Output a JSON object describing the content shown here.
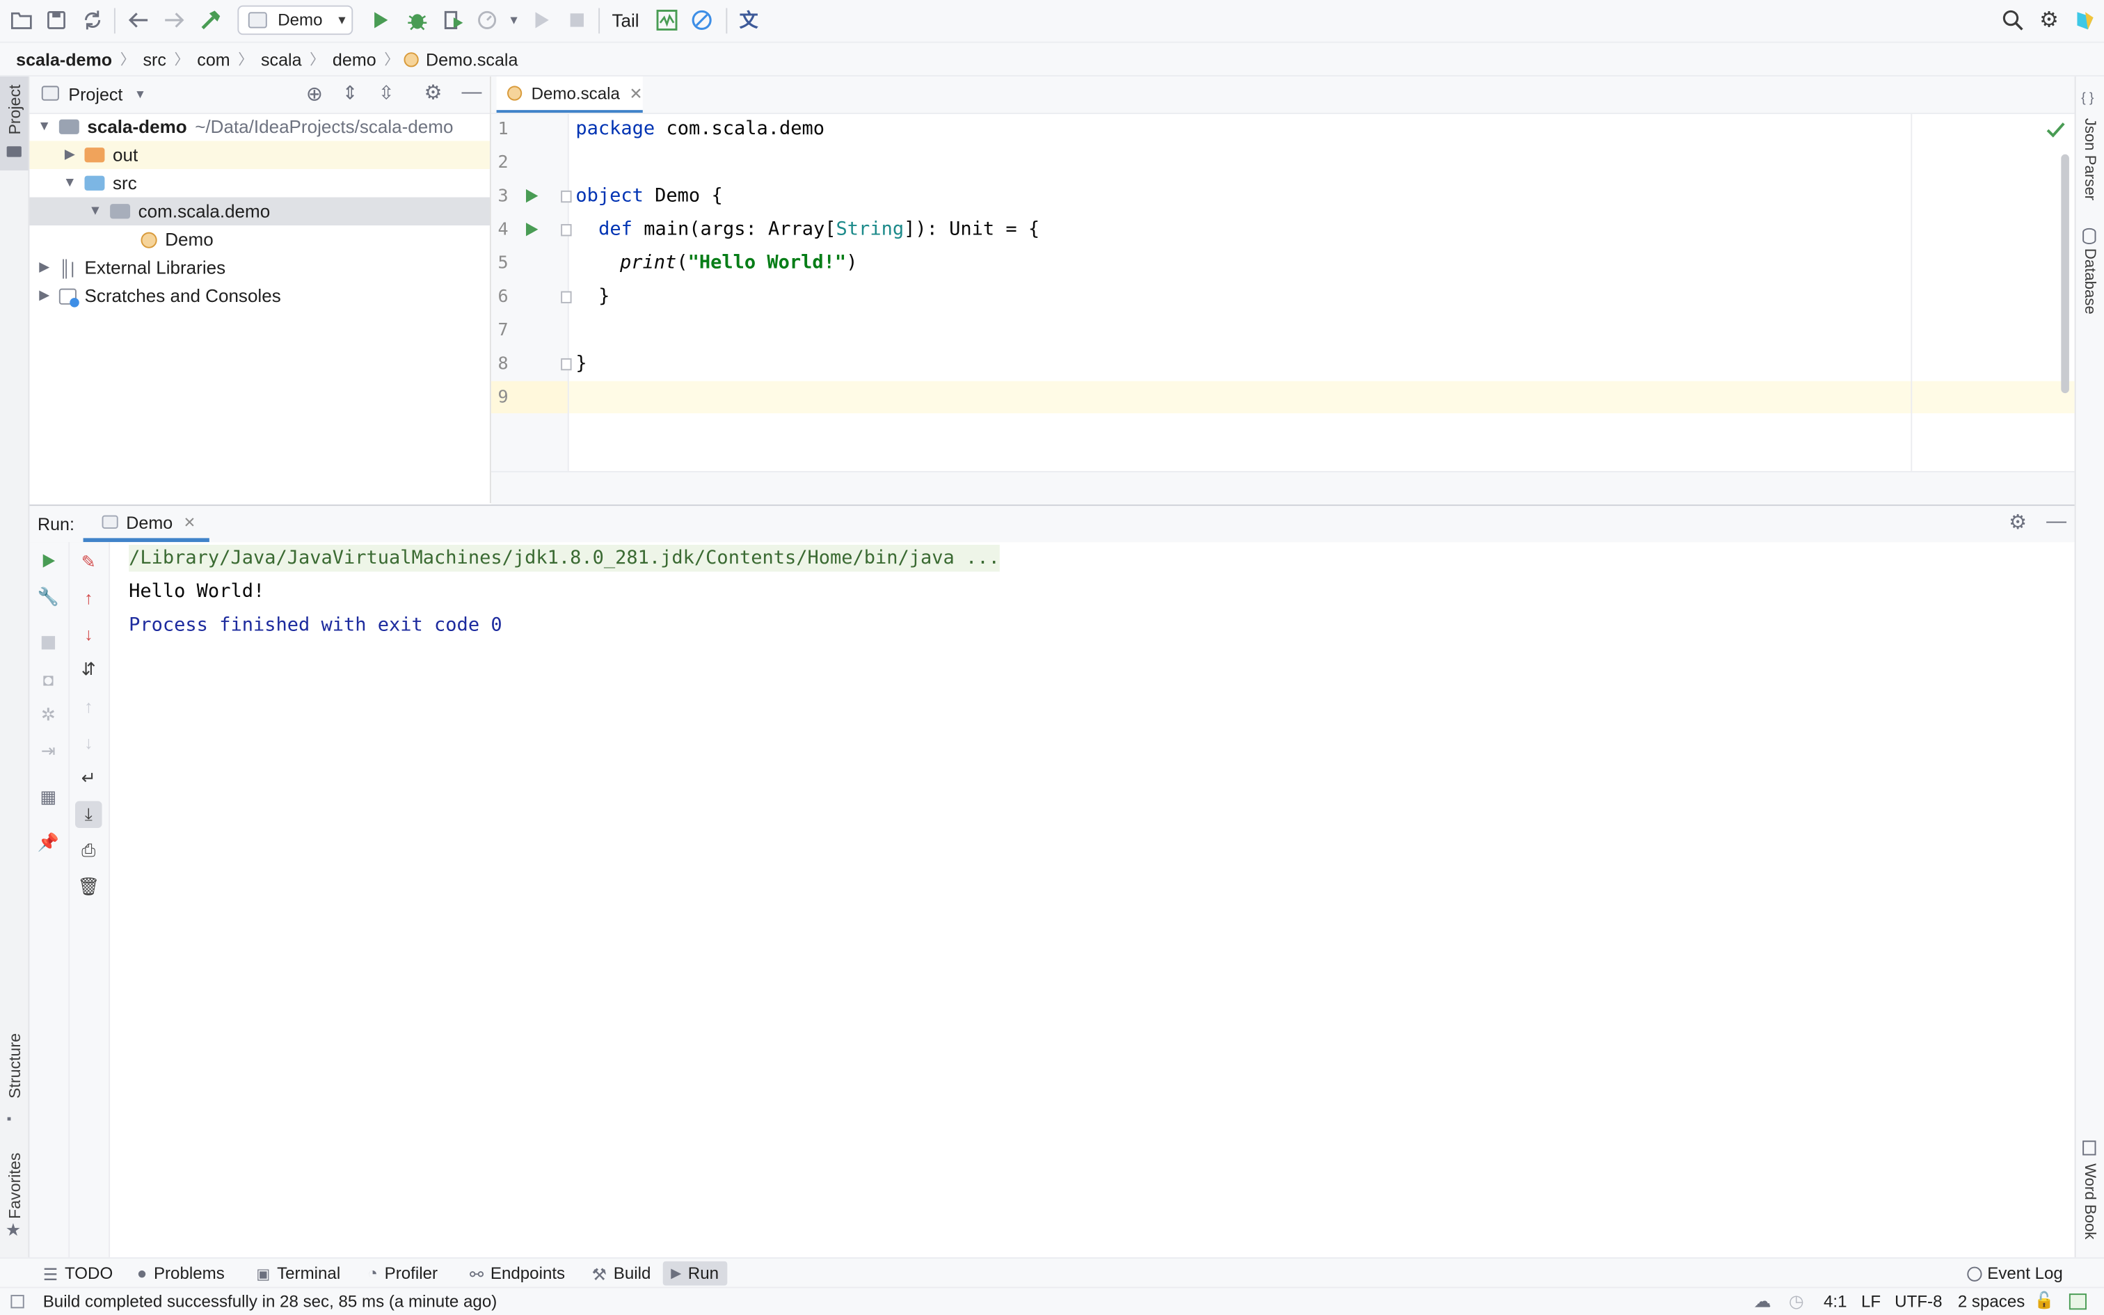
{
  "colors": {
    "accent": "#4083c9",
    "run_green": "#499c54",
    "error_red": "#d24b4b",
    "folder_orange": "#f0a35b",
    "folder_blue": "#7cb6e4",
    "selection": "#e0e1e6",
    "current_line": "#fffbe6"
  },
  "toolbar": {
    "run_config": "Demo",
    "tail_label": "Tail",
    "icons": [
      "open-folder-icon",
      "save-icon",
      "sync-icon",
      "back-icon",
      "forward-icon",
      "build-hammer-icon",
      "run-icon",
      "debug-icon",
      "coverage-icon",
      "profile-icon",
      "more-run-icon",
      "resume-icon",
      "stop-icon",
      "tail-chart-icon",
      "no-entry-icon",
      "translate-icon",
      "search-icon",
      "settings-icon",
      "jetbrains-logo"
    ]
  },
  "breadcrumb": [
    "scala-demo",
    "src",
    "com",
    "scala",
    "demo",
    "Demo.scala"
  ],
  "left_stripe": {
    "project": "Project",
    "structure": "Structure",
    "favorites": "Favorites"
  },
  "right_stripe": {
    "json_parser": "Json Parser",
    "database": "Database",
    "word_book": "Word Book"
  },
  "project_panel": {
    "title": "Project",
    "tree": {
      "root_name": "scala-demo",
      "root_path": "~/Data/IdeaProjects/scala-demo",
      "out": "out",
      "src": "src",
      "package": "com.scala.demo",
      "demo": "Demo",
      "external_libraries": "External Libraries",
      "scratches": "Scratches and Consoles"
    }
  },
  "editor": {
    "tab_label": "Demo.scala",
    "line_numbers": [
      "1",
      "2",
      "3",
      "4",
      "5",
      "6",
      "7",
      "8",
      "9"
    ],
    "code": {
      "l1_kw": "package",
      "l1_rest": " com.scala.demo",
      "l3_kw": "object",
      "l3_rest": " Demo {",
      "l4_kw": "def",
      "l4_a": " main(args: Array[",
      "l4_type": "String",
      "l4_b": "]): Unit = {",
      "l5_fn": "print",
      "l5_open": "(",
      "l5_str": "\"Hello World!\"",
      "l5_close": ")",
      "l6": "}",
      "l8": "}"
    }
  },
  "run_panel": {
    "label": "Run:",
    "tab_label": "Demo",
    "console": {
      "command": "/Library/Java/JavaVirtualMachines/jdk1.8.0_281.jdk/Contents/Home/bin/java ...",
      "output": "Hello World!",
      "exit": "Process finished with exit code 0"
    }
  },
  "tool_tabs": {
    "todo": "TODO",
    "problems": "Problems",
    "terminal": "Terminal",
    "profiler": "Profiler",
    "endpoints": "Endpoints",
    "build": "Build",
    "run": "Run",
    "event_log": "Event Log"
  },
  "status_bar": {
    "message": "Build completed successfully in 28 sec, 85 ms (a minute ago)",
    "position": "4:1",
    "line_sep": "LF",
    "encoding": "UTF-8",
    "indent": "2 spaces"
  }
}
